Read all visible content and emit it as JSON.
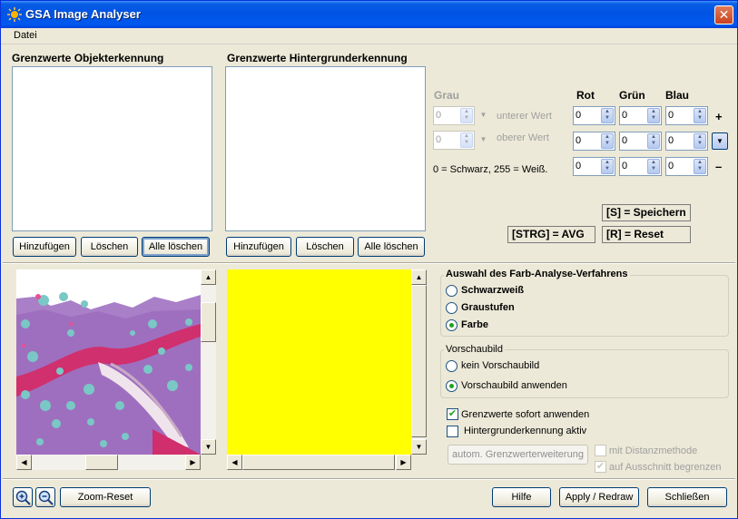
{
  "window": {
    "title": "GSA Image Analyser",
    "close_label": "✕"
  },
  "menu": {
    "datei": "Datei"
  },
  "object_panel": {
    "title": "Grenzwerte Objekterkennung",
    "add": "Hinzufügen",
    "delete": "Löschen",
    "delete_all": "Alle löschen"
  },
  "background_panel": {
    "title": "Grenzwerte Hintergrunderkennung",
    "add": "Hinzufügen",
    "delete": "Löschen",
    "delete_all": "Alle löschen"
  },
  "thresholds": {
    "gray_label": "Grau",
    "red_label": "Rot",
    "green_label": "Grün",
    "blue_label": "Blau",
    "lower_label": "unterer Wert",
    "upper_label": "oberer Wert",
    "gray_lower": "0",
    "gray_upper": "0",
    "row1": {
      "r": "0",
      "g": "0",
      "b": "0"
    },
    "row2": {
      "r": "0",
      "g": "0",
      "b": "0"
    },
    "row3": {
      "r": "0",
      "g": "0",
      "b": "0"
    },
    "plus": "+",
    "minus": "–",
    "legend": "0 = Schwarz, 255 = Weiß."
  },
  "shortcuts": {
    "save": "[S] = Speichern",
    "avg": "[STRG] = AVG",
    "reset": "[R] = Reset"
  },
  "preview": {
    "color": "#ffff00"
  },
  "analysis_group": {
    "title": "Auswahl des Farb-Analyse-Verfahrens",
    "options": [
      "Schwarzweiß",
      "Graustufen",
      "Farbe"
    ],
    "selected": "Farbe"
  },
  "preview_group": {
    "title": "Vorschaubild",
    "options": [
      "kein Vorschaubild",
      "Vorschaubild anwenden"
    ],
    "selected": "Vorschaubild anwenden"
  },
  "options": {
    "apply_immediately": "Grenzwerte sofort anwenden",
    "background_active": "Hintergrunderkennung aktiv",
    "auto_extend": "autom. Grenzwerterweiterung",
    "distance_method": "mit Distanzmethode",
    "limit_crop": "auf Ausschnitt begrenzen",
    "apply_immediately_checked": true,
    "background_active_checked": false,
    "distance_method_checked": false,
    "limit_crop_checked": true
  },
  "footer": {
    "zoom_reset": "Zoom-Reset",
    "help": "Hilfe",
    "apply": "Apply / Redraw",
    "close": "Schließen"
  }
}
